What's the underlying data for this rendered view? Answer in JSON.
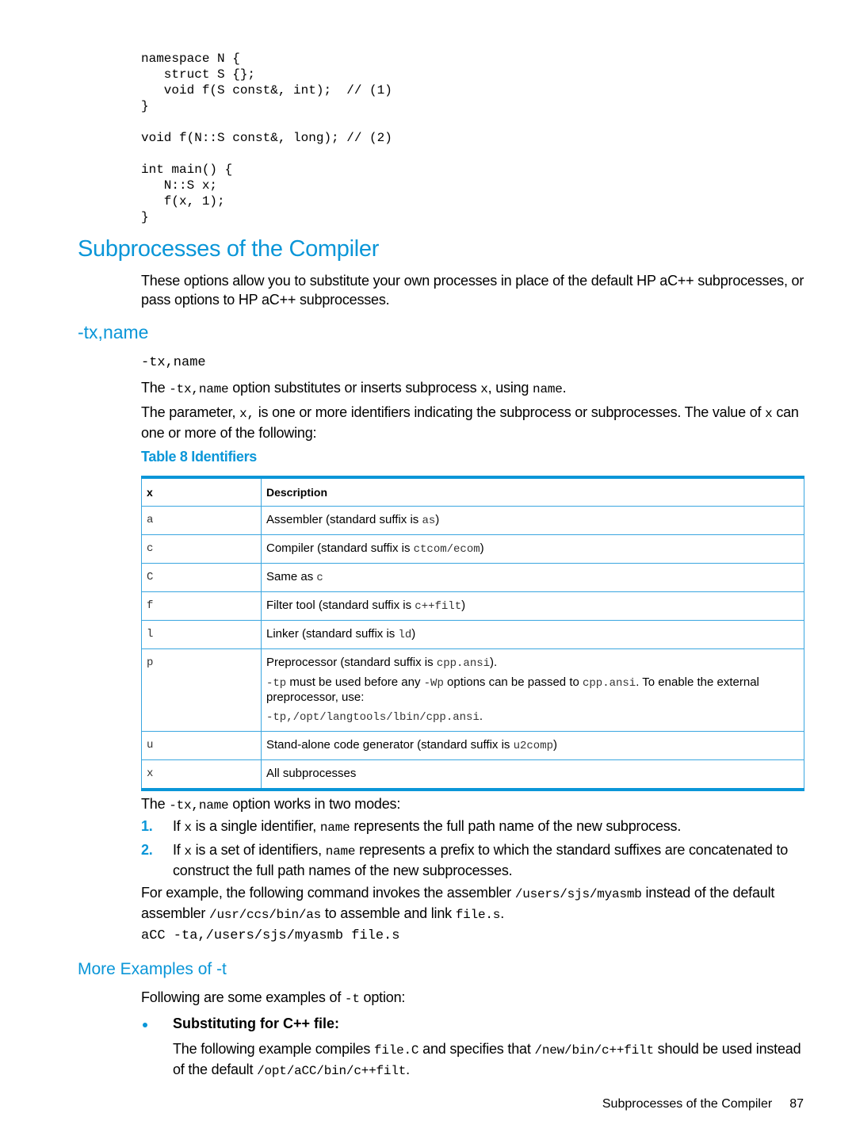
{
  "code_example": {
    "lines": [
      "namespace N {",
      "   struct S {};",
      "   void f(S const&, int);  // (1)",
      "}",
      "",
      "void f(N::S const&, long); // (2)",
      "",
      "int main() {",
      "   N::S x;",
      "   f(x, 1);",
      "}"
    ]
  },
  "section": {
    "title": "Subprocesses of the Compiler",
    "intro": "These options allow you to substitute your own processes in place of the default HP aC++ subprocesses, or pass options to HP aC++ subprocesses."
  },
  "option": {
    "heading": "-tx,name",
    "syntax": "-tx,name",
    "desc1": {
      "a": "The ",
      "code1": "-tx,name",
      "b": " option substitutes or inserts subprocess ",
      "code2": "x",
      "c": ", using ",
      "code3": "name",
      "d": "."
    },
    "desc2": {
      "a": "The parameter, ",
      "code1": "x,",
      "b": " is one or more identifiers indicating the subprocess or subprocesses. The value of ",
      "code2": "x",
      "c": " can one or more of the following:"
    }
  },
  "table": {
    "caption": "Table 8 Identifiers",
    "headers": [
      "x",
      "Description"
    ],
    "rows": [
      {
        "x": "a",
        "pre": "Assembler (standard suffix is ",
        "code": "as",
        "post": ")"
      },
      {
        "x": "c",
        "pre": "Compiler (standard suffix is ",
        "code": "ctcom/ecom",
        "post": ")"
      },
      {
        "x": "C",
        "pre": "Same as ",
        "code": "c",
        "post": ""
      },
      {
        "x": "f",
        "pre": "Filter tool (standard suffix is ",
        "code": "c++filt",
        "post": ")"
      },
      {
        "x": "l",
        "pre": "Linker (standard suffix is ",
        "code": "ld",
        "post": ")"
      },
      {
        "x": "p",
        "pre": "Preprocessor (standard suffix is ",
        "code": "cpp.ansi",
        "post": ").",
        "note": {
          "code1": "-tp",
          "a": " must be used before any ",
          "code2": "-Wp",
          "b": " options can be passed to ",
          "code3": "cpp.ansi",
          "c": ". To enable the external preprocessor, use:"
        },
        "example": "-tp,/opt/langtools/lbin/cpp.ansi",
        "example_post": "."
      },
      {
        "x": "u",
        "pre": "Stand-alone code generator (standard suffix is ",
        "code": "u2comp",
        "post": ")"
      },
      {
        "x": "x",
        "pre": "All subprocesses",
        "code": "",
        "post": ""
      }
    ]
  },
  "modes": {
    "intro": {
      "a": "The ",
      "code": "-tx,name",
      "b": " option works in two modes:"
    },
    "items": [
      {
        "num": "1.",
        "a": "If ",
        "code1": "x",
        "b": " is a single identifier, ",
        "code2": "name",
        "c": " represents the full path name of the new subprocess."
      },
      {
        "num": "2.",
        "a": "If ",
        "code1": "x",
        "b": " is a set of identifiers, ",
        "code2": "name",
        "c": " represents a prefix to which the standard suffixes are concatenated to construct the full path names of the new subprocesses."
      }
    ]
  },
  "example": {
    "a": "For example, the following command invokes the assembler ",
    "code1": "/users/sjs/myasmb",
    "b": " instead of the default assembler ",
    "code2": "/usr/ccs/bin/as",
    "c": " to assemble and link ",
    "code3": "file.s",
    "d": ".",
    "command": "aCC -ta,/users/sjs/myasmb file.s"
  },
  "more_examples": {
    "heading": "More Examples of -t",
    "intro": {
      "a": "Following are some examples of ",
      "code": "-t",
      "b": " option:"
    },
    "bullet_title": "Substituting for C++ file:",
    "bullet_body": {
      "a": "The following example compiles ",
      "code1": "file.C",
      "b": " and specifies that ",
      "code2": "/new/bin/c++filt",
      "c": " should be used instead of the default ",
      "code3": "/opt/aCC/bin/c++filt",
      "d": "."
    }
  },
  "footer": {
    "section": "Subprocesses of the Compiler",
    "page": "87"
  }
}
